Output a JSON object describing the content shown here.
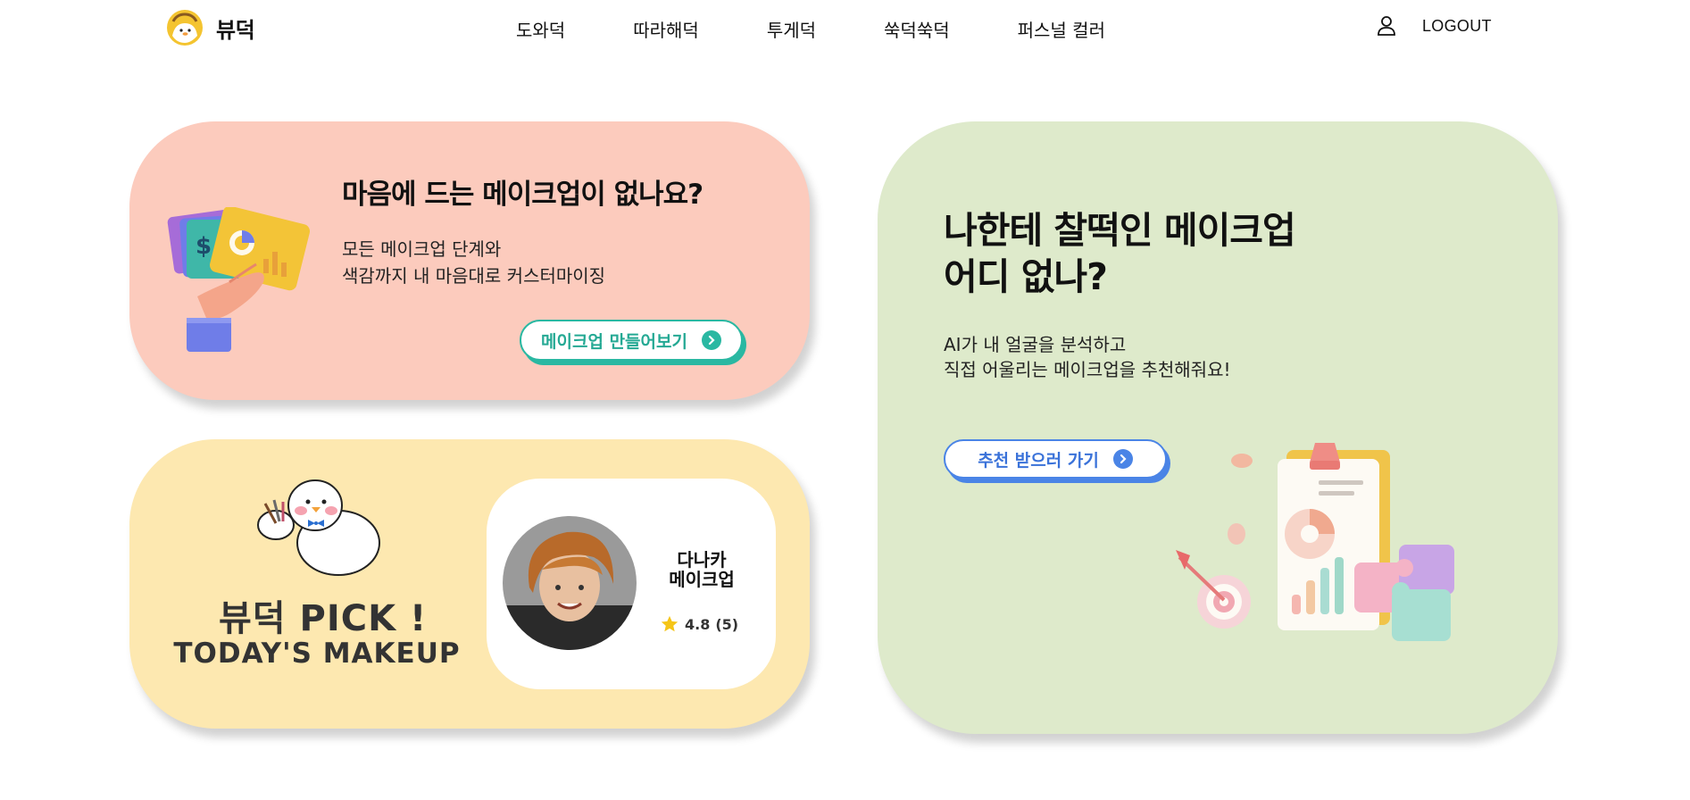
{
  "header": {
    "logo_text": "뷰덕",
    "nav": [
      "도와덕",
      "따라해덕",
      "투게덕",
      "쑥덕쑥덕",
      "퍼스널 컬러"
    ],
    "logout": "LOGOUT"
  },
  "card_custom": {
    "title": "마음에 드는 메이크업이 없나요?",
    "desc_line1": "모든 메이크업 단계와",
    "desc_line2": "색감까지 내 마음대로 커스터마이징",
    "button": "메이크업 만들어보기"
  },
  "card_pick": {
    "title": "뷰덕 PICK !",
    "subtitle": "TODAY'S MAKEUP",
    "name_line1": "다나카",
    "name_line2": "메이크업",
    "rating": "4.8",
    "review_count": "(5)"
  },
  "card_recommend": {
    "title_line1": "나한테 찰떡인 메이크업",
    "title_line2": "어디 없나?",
    "desc_line1": "AI가 내 얼굴을 분석하고",
    "desc_line2": "직접 어울리는 메이크업을 추천해줘요!",
    "button": "추천 받으러 가기"
  },
  "colors": {
    "pink_card": "#fccbbd",
    "yellow_card": "#fde8b0",
    "green_card": "#deeacb",
    "teal_accent": "#2ab8a2",
    "blue_accent": "#4a84e6"
  },
  "icons": [
    "duck-logo-icon",
    "user-icon",
    "chevron-right-icon",
    "star-icon"
  ]
}
